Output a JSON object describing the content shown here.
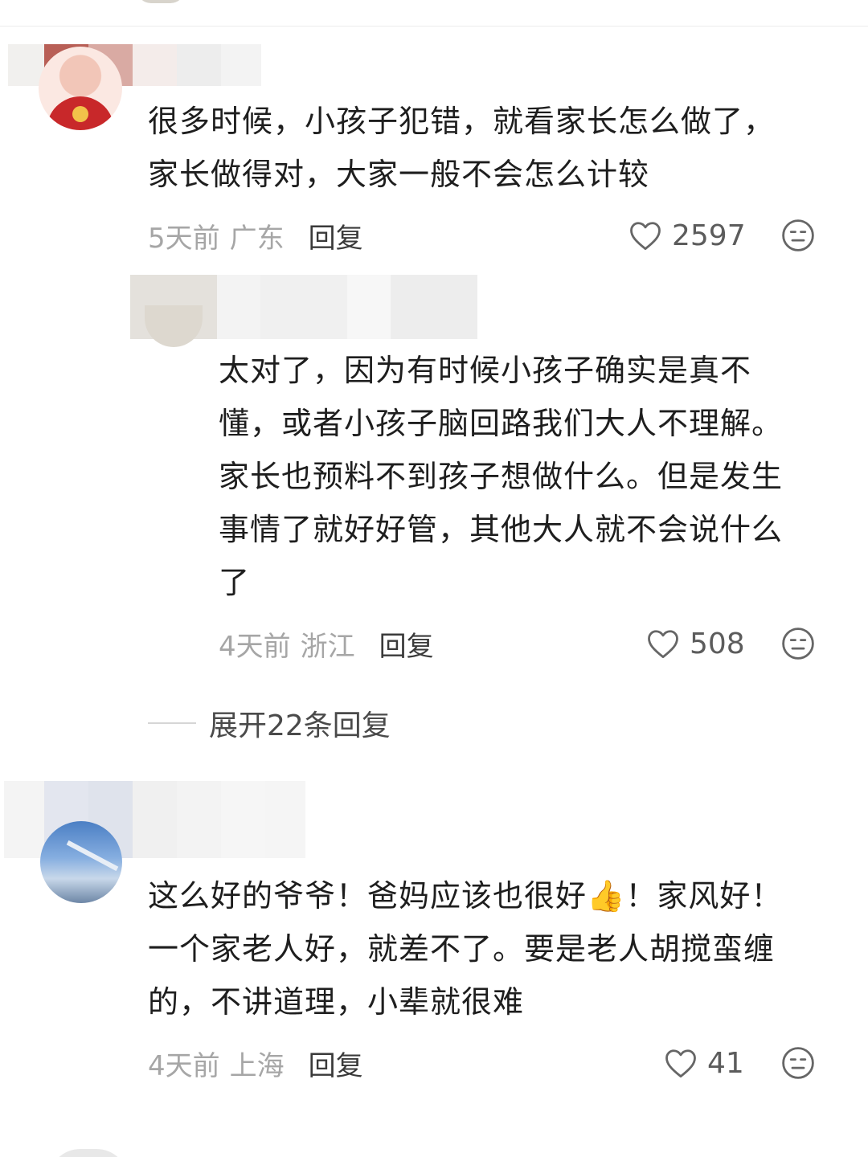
{
  "comments": [
    {
      "text_lines": [
        "很多时候，小孩子犯错，就看家长怎么做了，",
        "家长做得对，大家一般不会怎么计较"
      ],
      "time": "5天前",
      "location": "广东",
      "reply_label": "回复",
      "likes": "2597",
      "avatar_icon": "cartoon-avatar",
      "replies": [
        {
          "text_lines": [
            "太对了，因为有时候小孩子确实是真不",
            "懂，或者小孩子脑回路我们大人不理解。",
            "家长也预料不到孩子想做什么。但是发生",
            "事情了就好好管，其他大人就不会说什么",
            "了"
          ],
          "time": "4天前",
          "location": "浙江",
          "reply_label": "回复",
          "likes": "508"
        }
      ],
      "expand_label": "展开22条回复"
    },
    {
      "text_lines": [
        "这么好的爷爷！爸妈应该也很好👍！家风好！",
        "一个家老人好，就差不了。要是老人胡搅蛮缠",
        "的，不讲道理，小辈就很难"
      ],
      "time": "4天前",
      "location": "上海",
      "reply_label": "回复",
      "likes": "41",
      "avatar_icon": "sky-photo-avatar"
    }
  ],
  "icons": {
    "like": "heart-outline-icon",
    "react": "meh-face-icon"
  },
  "colors": {
    "text": "#1e1e1e",
    "meta": "#a6a6a6",
    "reply": "#3a3a3a"
  }
}
